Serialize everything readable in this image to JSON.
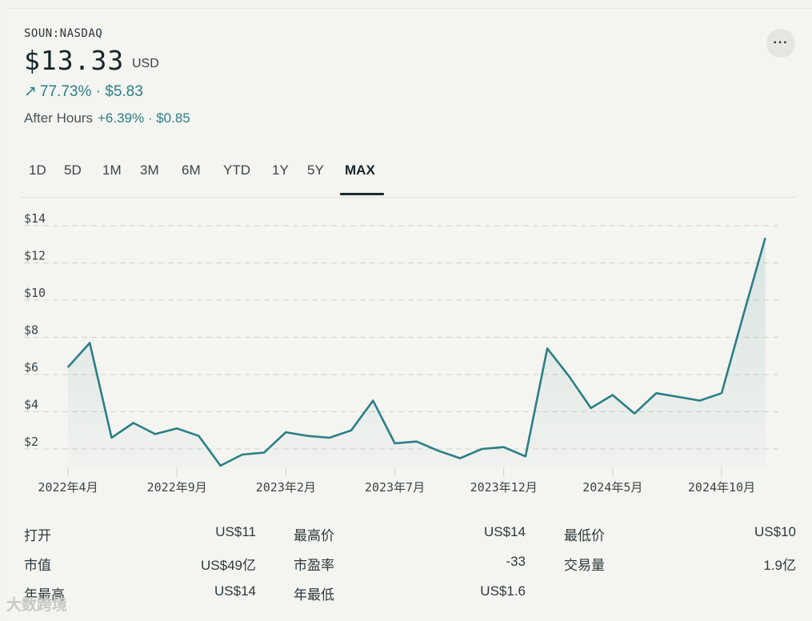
{
  "header": {
    "ticker": "SOUN:NASDAQ",
    "price": "$13.33",
    "currency": "USD",
    "change_arrow": "↗",
    "change": "77.73% · $5.83",
    "after_hours_label": "After Hours",
    "after_hours_value": "+6.39% · $0.85",
    "more_icon": "···"
  },
  "tabs": [
    {
      "label": "1D"
    },
    {
      "label": "5D"
    },
    {
      "label": "1M"
    },
    {
      "label": "3M"
    },
    {
      "label": "6M"
    },
    {
      "label": "YTD"
    },
    {
      "label": "1Y"
    },
    {
      "label": "5Y"
    },
    {
      "label": "MAX",
      "active": true
    }
  ],
  "chart_data": {
    "type": "line",
    "ylim": [
      0.5,
      14.5
    ],
    "yticks": [
      2,
      4,
      6,
      8,
      10,
      12,
      14
    ],
    "ytick_labels": [
      "$2",
      "$4",
      "$6",
      "$8",
      "$10",
      "$12",
      "$14"
    ],
    "xtick_labels": [
      "2022年4月",
      "2022年9月",
      "2023年2月",
      "2023年7月",
      "2023年12月",
      "2024年5月",
      "2024年10月"
    ],
    "xtick_index": [
      0,
      5,
      10,
      15,
      20,
      25,
      30
    ],
    "series": [
      {
        "values": [
          6.4,
          7.7,
          2.6,
          3.4,
          2.8,
          3.1,
          2.7,
          1.1,
          1.7,
          1.8,
          2.9,
          2.7,
          2.6,
          3.0,
          4.6,
          2.3,
          2.4,
          1.9,
          1.5,
          2.0,
          2.1,
          1.6,
          7.4,
          5.9,
          4.2,
          4.9,
          3.9,
          5.0,
          4.8,
          4.6,
          5.0,
          9.2,
          13.33
        ],
        "x_index": [
          -1,
          0,
          1,
          2,
          3,
          4,
          5,
          6,
          7,
          8,
          9,
          10,
          11,
          12,
          13,
          14,
          15,
          16,
          17,
          18,
          19,
          20,
          21,
          22,
          23,
          24,
          25,
          26,
          27,
          28,
          29,
          30,
          31
        ]
      }
    ],
    "colors": {
      "line": "#2b7f86",
      "grid": "#d2d2cc"
    },
    "grid": true
  },
  "stats": [
    [
      {
        "label": "打开",
        "value": "US$11"
      },
      {
        "label": "最高价",
        "value": "US$14"
      },
      {
        "label": "最低价",
        "value": "US$10"
      }
    ],
    [
      {
        "label": "市值",
        "value": "US$49亿"
      },
      {
        "label": "市盈率",
        "value": "-33"
      },
      {
        "label": "交易量",
        "value": "1.9亿"
      }
    ],
    [
      {
        "label": "年最高",
        "value": "US$14"
      },
      {
        "label": "年最低",
        "value": "US$1.6"
      }
    ]
  ],
  "watermark": "大数跨境"
}
